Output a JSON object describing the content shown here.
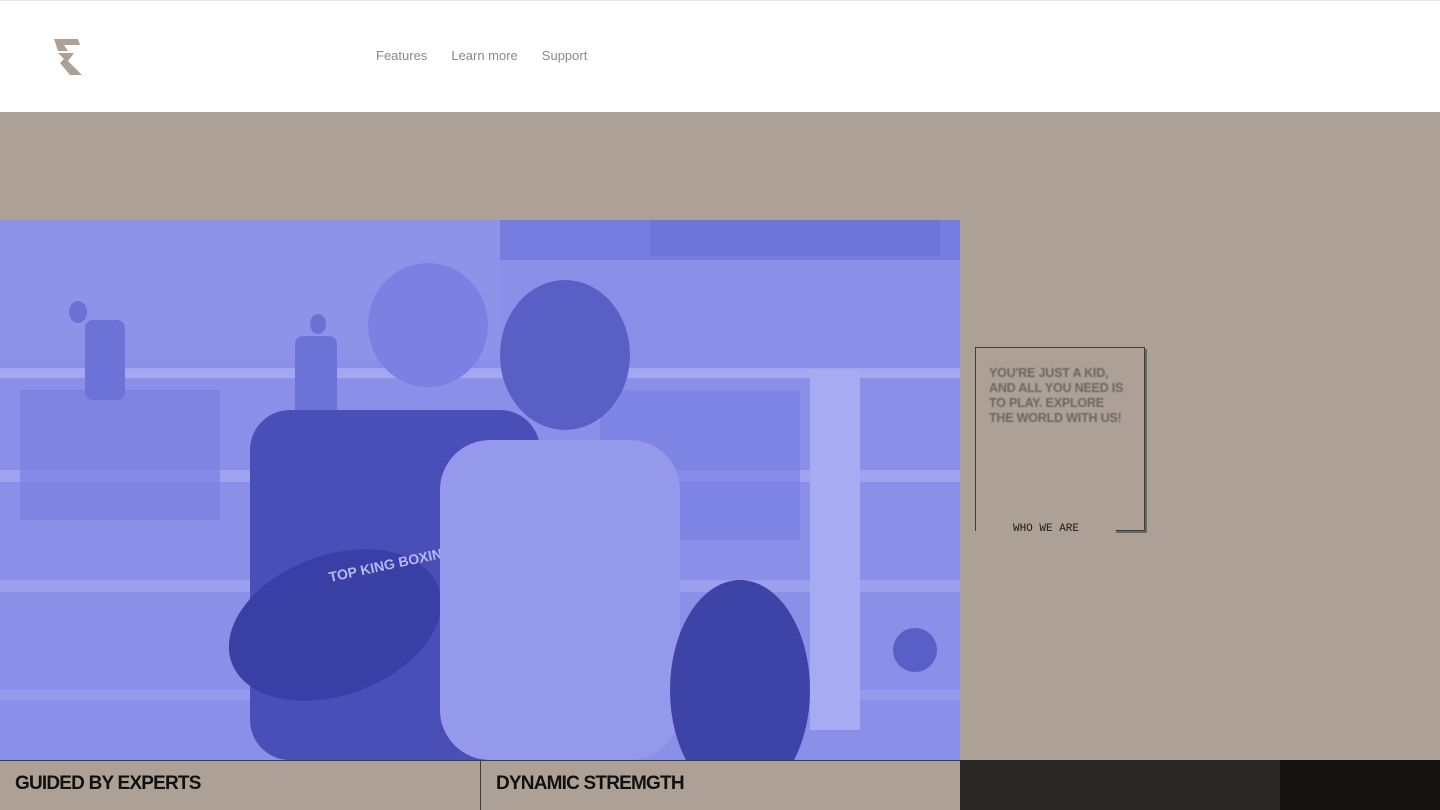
{
  "header": {
    "logo": "brand-logo-icon",
    "nav": [
      {
        "label": "Features"
      },
      {
        "label": "Learn more"
      },
      {
        "label": "Support"
      }
    ]
  },
  "hero": {
    "image": "boxing-training-photo",
    "photo_text": "TOP KING BOXING",
    "card": {
      "text": "YOU'RE JUST A KID, AND ALL YOU NEED IS TO PLAY. EXPLORE THE WORLD WITH US!",
      "button_label": "WHO WE ARE"
    }
  },
  "features": [
    {
      "title": "GUIDED BY EXPERTS"
    },
    {
      "title": "DYNAMIC STREMGTH"
    }
  ],
  "colors": {
    "band": "#ada197",
    "photo_tint": "#8287e4",
    "header_bg": "#ffffff",
    "card_text": "#6b6661"
  }
}
